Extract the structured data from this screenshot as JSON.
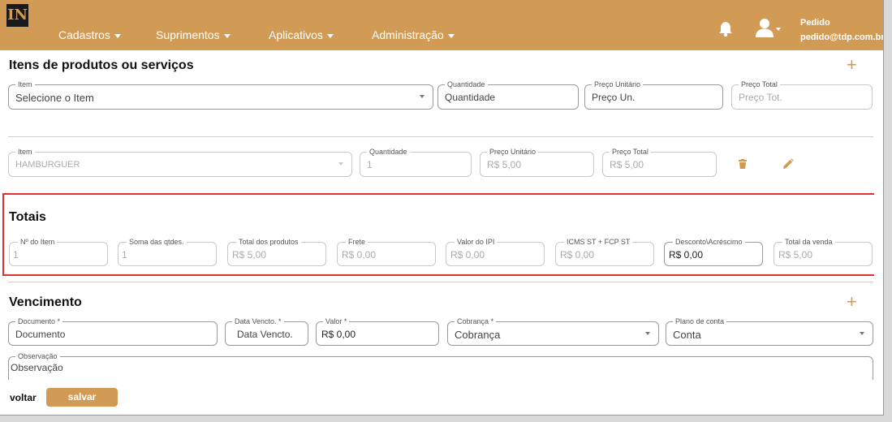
{
  "nav": {
    "logo": "IN",
    "menu": [
      {
        "label": "Cadastros"
      },
      {
        "label": "Suprimentos"
      },
      {
        "label": "Aplicativos"
      },
      {
        "label": "Administração"
      }
    ],
    "user_name": "Pedido",
    "user_email": "pedido@tdp.com.br"
  },
  "itens": {
    "title": "Itens de produtos ou serviços",
    "new_row": {
      "item": {
        "label": "Item",
        "placeholder": "Selecione o Item"
      },
      "quantidade": {
        "label": "Quantidade",
        "placeholder": "Quantidade"
      },
      "preco_unitario": {
        "label": "Preço Unitário",
        "placeholder": "Preço Un."
      },
      "preco_total": {
        "label": "Preço Total",
        "placeholder": "Preço Tot."
      }
    },
    "rows": [
      {
        "item": {
          "label": "Item",
          "value": "HAMBURGUER"
        },
        "quantidade": {
          "label": "Quantidade",
          "value": "1"
        },
        "preco_unitario": {
          "label": "Preço Unitário",
          "value": "R$ 5,00"
        },
        "preco_total": {
          "label": "Preço Total",
          "value": "R$ 5,00"
        }
      }
    ]
  },
  "totais": {
    "title": "Totais",
    "fields": [
      {
        "label": "Nº do Item",
        "value": "1"
      },
      {
        "label": "Soma das qtdes.",
        "value": "1"
      },
      {
        "label": "Total dos produtos",
        "value": "R$ 5,00"
      },
      {
        "label": "Frete",
        "value": "R$ 0,00"
      },
      {
        "label": "Valor do IPI",
        "value": "R$ 0,00"
      },
      {
        "label": "ICMS ST + FCP ST",
        "value": "R$ 0,00"
      },
      {
        "label": "Desconto\\Acréscimo",
        "value": "R$ 0,00"
      },
      {
        "label": "Total da venda",
        "value": "R$ 5,00"
      }
    ]
  },
  "vencimento": {
    "title": "Vencimento",
    "documento": {
      "label": "Documento *",
      "placeholder": "Documento"
    },
    "data_vencto": {
      "label": "Data Vencto. *",
      "placeholder": "Data Vencto."
    },
    "valor": {
      "label": "Valor *",
      "value": "R$ 0,00"
    },
    "cobranca": {
      "label": "Cobrança *",
      "placeholder": "Cobrança"
    },
    "plano_conta": {
      "label": "Plano de conta",
      "placeholder": "Conta"
    },
    "observacao": {
      "label": "Observação",
      "placeholder": "Observação"
    }
  },
  "footer": {
    "voltar": "voltar",
    "salvar": "salvar"
  },
  "colors": {
    "brand": "#d19b55",
    "highlight": "#e03030"
  },
  "icons": [
    "bell-icon",
    "user-icon",
    "plus-icon",
    "trash-icon",
    "pencil-icon",
    "chevron-down-icon"
  ]
}
